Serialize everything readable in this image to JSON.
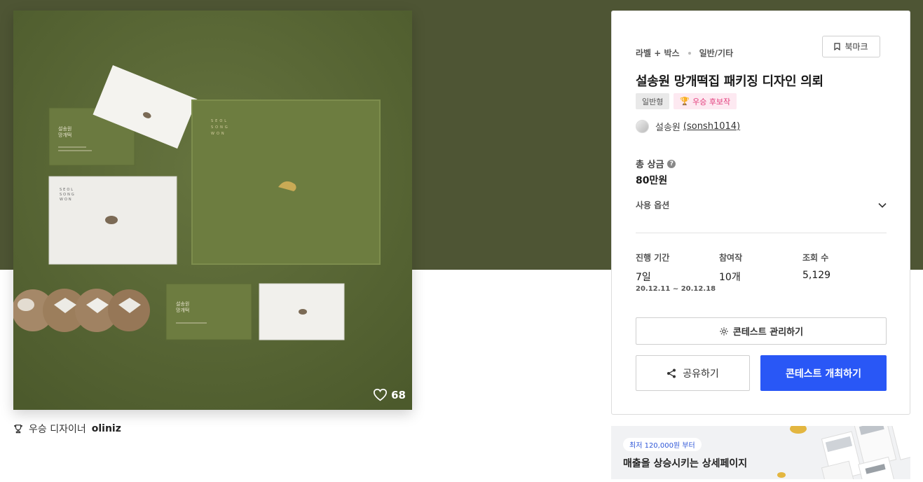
{
  "product": {
    "like_count": "68",
    "winner_prefix": "우승 디자이너",
    "winner_name": "oliniz"
  },
  "contest": {
    "category": "라벨 + 박스",
    "subcategory": "일반/기타",
    "bookmark_label": "북마크",
    "title": "설송원 망개떡집 패키징 디자인 의뢰",
    "tag_type": "일반형",
    "tag_winner": "우승 후보작",
    "designer_name": "설송원",
    "designer_id": "(sonsh1014)",
    "prize_label": "총 상금",
    "prize_value": "80만원",
    "options_label": "사용 옵션",
    "stats": {
      "period_label": "진행 기간",
      "period_value": "7일",
      "period_dates": "20.12.11 ~ 20.12.18",
      "entries_label": "참여작",
      "entries_value": "10개",
      "views_label": "조회 수",
      "views_value": "5,129"
    },
    "manage_label": "콘테스트 관리하기",
    "share_label": "공유하기",
    "host_label": "콘테스트 개최하기"
  },
  "ad": {
    "badge": "최저 120,000원 부터",
    "text": "매출을 상승시키는 상세페이지"
  },
  "mockup": {
    "box_lines": [
      "SEOL",
      "SONG",
      "WON"
    ],
    "card_name_lines": [
      "설송원",
      "망개떡"
    ]
  },
  "colors": {
    "hero_bg": "#4e5534",
    "accent_blue": "#2957f6",
    "winner_pink": "#e23b7b"
  }
}
